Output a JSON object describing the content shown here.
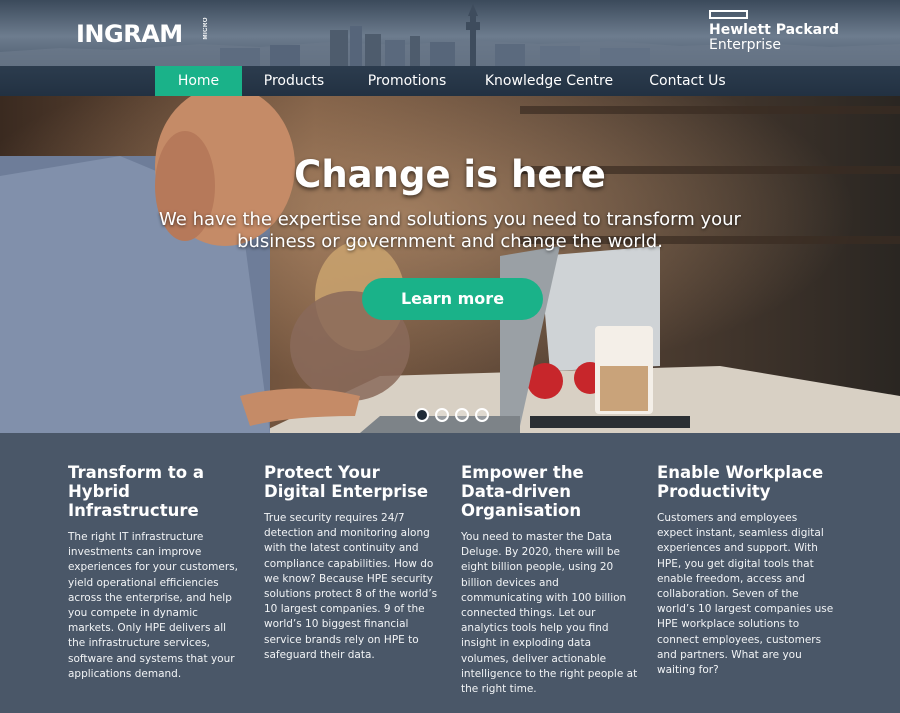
{
  "header": {
    "logo_text": "INGRAM",
    "logo_suffix": "MICRO",
    "partner_line1": "Hewlett Packard",
    "partner_line2": "Enterprise"
  },
  "nav": {
    "items": [
      {
        "label": "Home",
        "active": true
      },
      {
        "label": "Products",
        "active": false
      },
      {
        "label": "Promotions",
        "active": false
      },
      {
        "label": "Knowledge Centre",
        "active": false
      },
      {
        "label": "Contact Us",
        "active": false
      }
    ]
  },
  "hero": {
    "title": "Change is here",
    "subtitle": "We have the expertise and solutions you need to transform your business or government and change the world.",
    "button": "Learn more",
    "slides": 4,
    "active_slide": 1
  },
  "columns": [
    {
      "title": "Transform to a Hybrid Infrastructure",
      "body": "The right IT infrastructure investments can improve experiences for your customers, yield operational efficiencies across the enterprise, and help you compete in dynamic markets. Only HPE delivers all the infrastructure services, software and systems that your applications demand."
    },
    {
      "title": "Protect Your Digital Enterprise",
      "body": "True security requires 24/7 detection and monitoring along with the latest continuity and compliance capabilities. How do we know? Because HPE security solutions protect 8 of the world’s 10 largest companies. 9 of the world’s 10 biggest financial service brands rely on HPE to safeguard their data."
    },
    {
      "title": "Empower the Data-driven Organisation",
      "body": "You need to master the Data Deluge. By 2020, there will be eight billion people, using 20 billion devices and communicating with 100 billion connected things. Let our analytics tools help you find insight in exploding data volumes, deliver actionable intelligence to the right people at the right time."
    },
    {
      "title": "Enable Workplace Productivity",
      "body": "Customers and employees expect instant, seamless digital experiences and support. With HPE, you get digital tools that enable freedom, access and collaboration. Seven of the world’s 10 largest companies use HPE workplace solutions to connect employees, customers and partners. What are you waiting for?"
    }
  ],
  "colors": {
    "accent": "#1ab289",
    "nav_bg": "#243445",
    "content_bg": "#4a5768"
  }
}
